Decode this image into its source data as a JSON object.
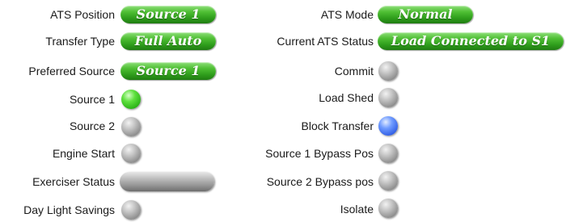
{
  "left": {
    "ats_position": {
      "label": "ATS Position",
      "value": "Source 1",
      "color": "#3aa824"
    },
    "transfer_type": {
      "label": "Transfer Type",
      "value": "Full Auto",
      "color": "#3aa824"
    },
    "preferred_source": {
      "label": "Preferred Source",
      "value": "Source 1",
      "color": "#3aa824"
    },
    "source_1": {
      "label": "Source 1",
      "state": "green"
    },
    "source_2": {
      "label": "Source 2",
      "state": "gray"
    },
    "engine_start": {
      "label": "Engine Start",
      "state": "gray"
    },
    "exerciser_status": {
      "label": "Exerciser Status",
      "state": "gray"
    },
    "day_light_savings": {
      "label": "Day Light Savings",
      "state": "gray"
    }
  },
  "right": {
    "ats_mode": {
      "label": "ATS Mode",
      "value": "Normal",
      "color": "#3aa824"
    },
    "current_ats_status": {
      "label": "Current ATS Status",
      "value": "Load Connected to S1",
      "color": "#3aa824"
    },
    "commit": {
      "label": "Commit",
      "state": "gray"
    },
    "load_shed": {
      "label": "Load Shed",
      "state": "gray"
    },
    "block_transfer": {
      "label": "Block Transfer",
      "state": "blue"
    },
    "source_1_bypass_pos": {
      "label": "Source 1 Bypass Pos",
      "state": "gray"
    },
    "source_2_bypass_pos": {
      "label": "Source 2 Bypass pos",
      "state": "gray"
    },
    "isolate": {
      "label": "Isolate",
      "state": "gray"
    }
  }
}
